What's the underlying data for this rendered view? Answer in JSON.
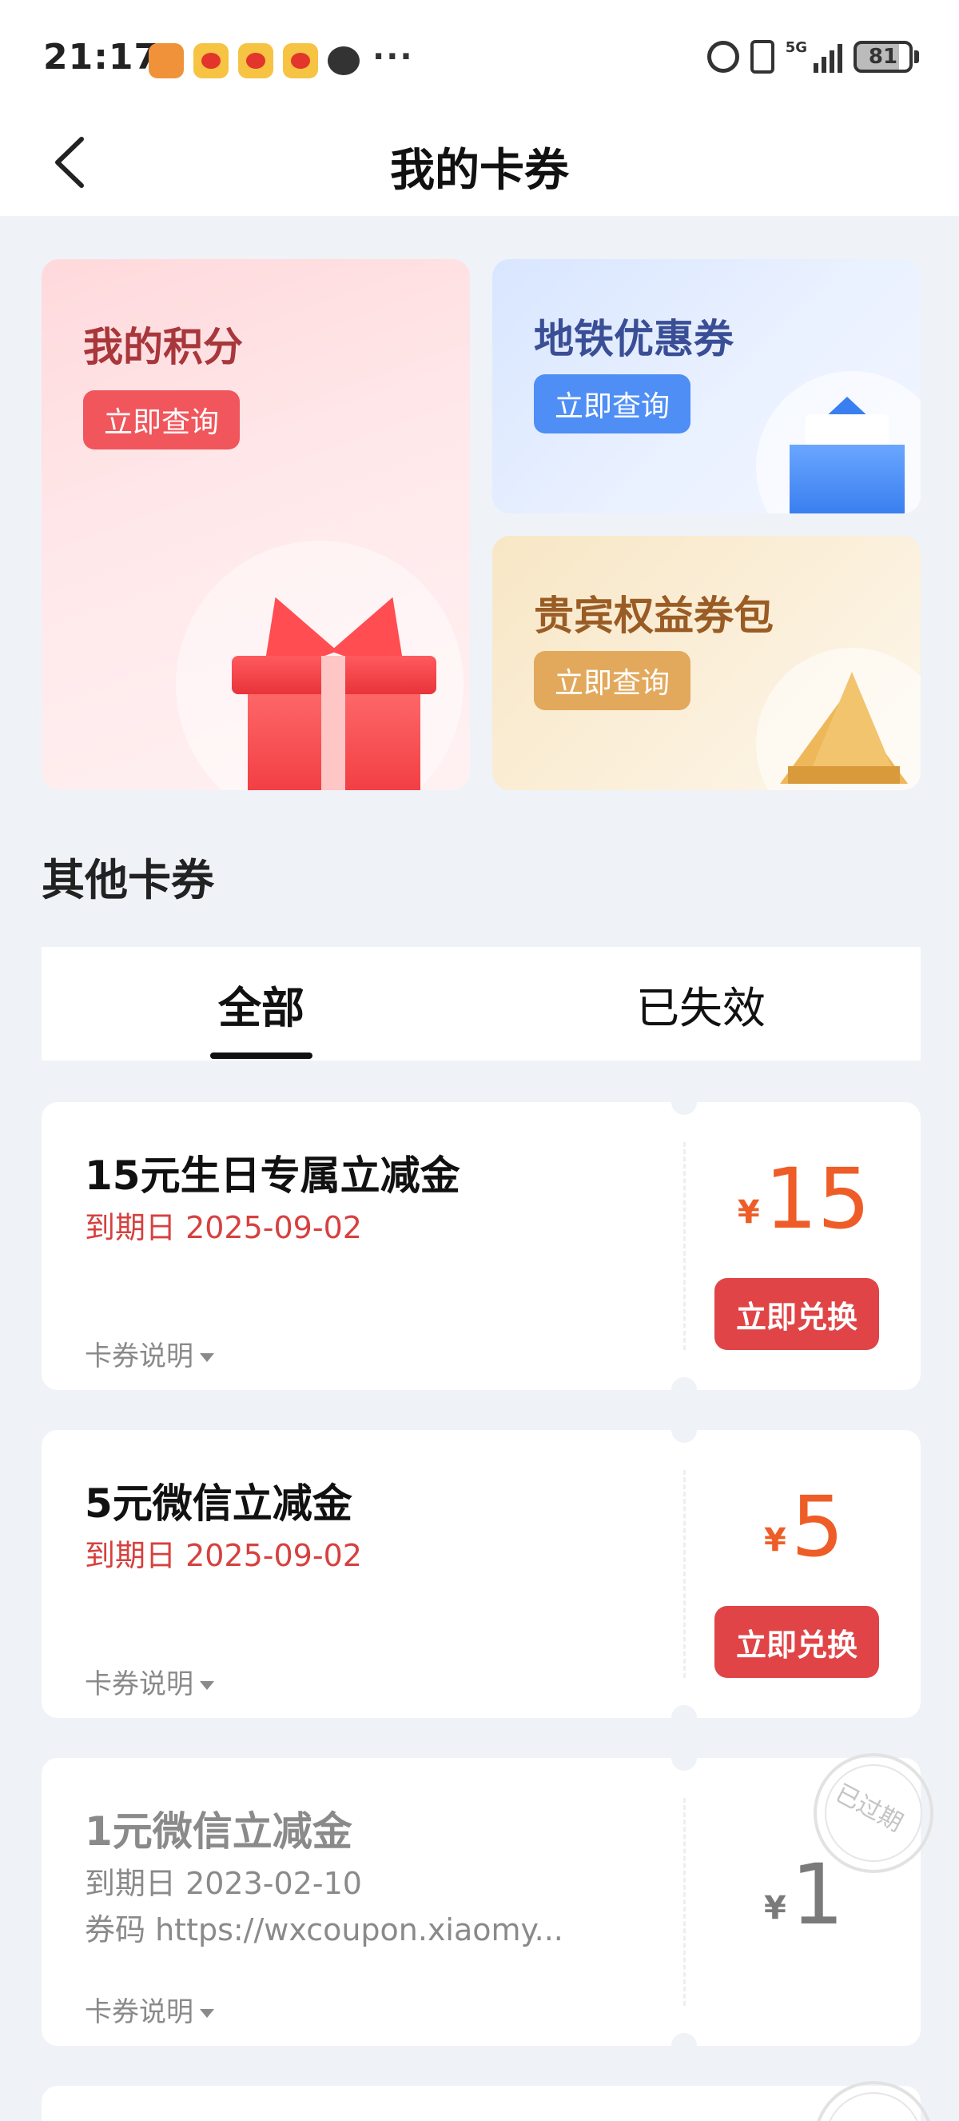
{
  "status_bar": {
    "time": "21:17",
    "network": "5G",
    "battery": "81"
  },
  "header": {
    "title": "我的卡券"
  },
  "promo_cards": {
    "points": {
      "title": "我的积分",
      "button": "立即查询"
    },
    "metro": {
      "title": "地铁优惠券",
      "button": "立即查询"
    },
    "vip": {
      "title": "贵宾权益券包",
      "button": "立即查询"
    }
  },
  "section": {
    "title": "其他卡券"
  },
  "tabs": [
    {
      "label": "全部",
      "active": true
    },
    {
      "label": "已失效",
      "active": false
    }
  ],
  "coupons": [
    {
      "name": "15元生日专属立减金",
      "expire": "到期日 2025-09-02",
      "desc": "卡券说明",
      "currency": "¥",
      "amount": "15",
      "button": "立即兑换"
    },
    {
      "name": "5元微信立减金",
      "expire": "到期日 2025-09-02",
      "desc": "卡券说明",
      "currency": "¥",
      "amount": "5",
      "button": "立即兑换"
    },
    {
      "name": "1元微信立减金",
      "expire": "到期日 2023-02-10",
      "code": "券码  https://wxcoupon.xiaomy...",
      "desc": "卡券说明",
      "currency": "¥",
      "amount": "1",
      "stamp": "已过期"
    }
  ],
  "colors": {
    "accent": "#e04446",
    "price": "#ee5d27",
    "expire": "#d6413f",
    "background": "#eff2f7"
  }
}
